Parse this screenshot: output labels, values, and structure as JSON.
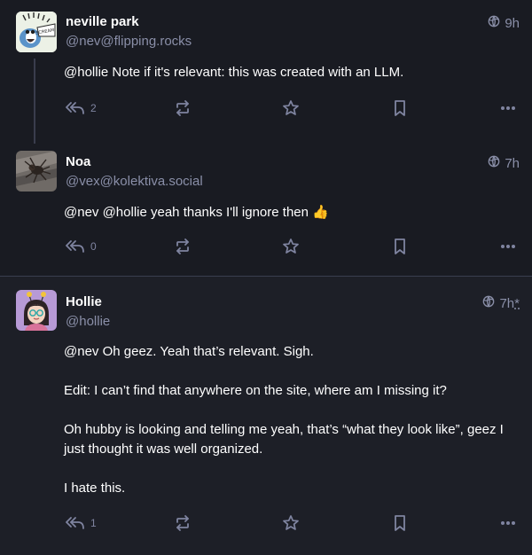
{
  "posts": [
    {
      "display_name": "neville park",
      "handle": "@nev@flipping.rocks",
      "time": "9h",
      "edited_mark": "",
      "content": [
        "@hollie Note if it's relevant: this was created with an LLM."
      ],
      "reply_count": "2",
      "avatar_caption": "SCREAM"
    },
    {
      "display_name": "Noa",
      "handle": "@vex@kolektiva.social",
      "time": "7h",
      "edited_mark": "",
      "content": [
        "@nev @hollie yeah thanks I'll ignore then 👍"
      ],
      "reply_count": "0"
    },
    {
      "display_name": "Hollie",
      "handle": "@hollie",
      "time": "7h",
      "edited_mark": "*",
      "content": [
        "@nev Oh geez. Yeah that’s relevant. Sigh.",
        "Edit: I can’t find that anywhere on the site, where am I missing it?",
        "Oh hubby is looking and telling me yeah, that’s “what they look like”, geez I just thought it was well organized.",
        "I hate this."
      ],
      "reply_count": "1"
    }
  ],
  "icons": {
    "visibility": "globe-icon",
    "reply": "reply-all-icon",
    "boost": "boost-icon",
    "favourite": "star-icon",
    "bookmark": "bookmark-icon",
    "more": "more-icon"
  },
  "colors": {
    "background": "#191b22",
    "focused_background": "#1d1f27",
    "muted_text": "#8a8fa8",
    "icon": "#7f84a0",
    "divider": "#393f4f"
  }
}
